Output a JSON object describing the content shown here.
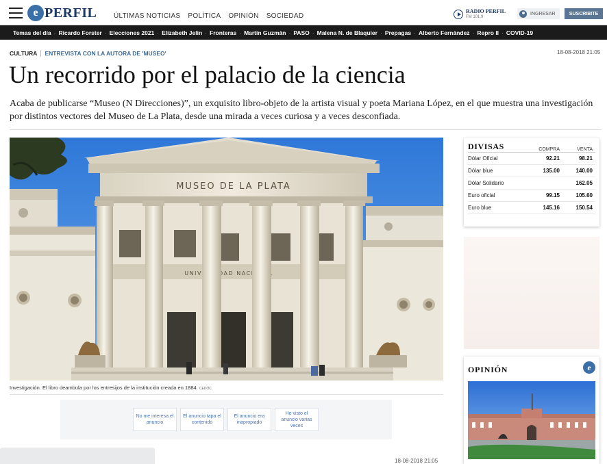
{
  "header": {
    "logo_text": "PERFIL",
    "nav": [
      "ÚLTIMAS NOTICIAS",
      "POLÍTICA",
      "OPINIÓN",
      "SOCIEDAD"
    ],
    "radio_name": "RADIO PERFIL",
    "radio_freq": "FM 101.9",
    "login_label": "INGRESAR",
    "subscribe_label": "SUSCRIBITE"
  },
  "topics": [
    "Temas del día",
    "Ricardo Forster",
    "Elecciones 2021",
    "Elizabeth Jelin",
    "Fronteras",
    "Martín Guzmán",
    "PASO",
    "Malena N. de Blaquier",
    "Prepagas",
    "Alberto Fernández",
    "Repro II",
    "COVID-19"
  ],
  "article": {
    "section": "CULTURA",
    "kicker": "ENTREVISTA CON LA AUTORA DE 'MUSEO'",
    "date": "18-08-2018 21:05",
    "title": "Un recorrido por el palacio de la ciencia",
    "lead": "Acaba de publicarse “Museo (N Direcciones)”, un exquisito libro-objeto de la artista visual y poeta Mariana López, en el que muestra una investigación por distintos vectores del Museo de La Plata, desde una mirada a veces curiosa y a veces desconfiada.",
    "photo_sign": "MUSEO DE LA PLATA",
    "photo_sign2": "UNIVERSIDAD NACIONAL",
    "caption": "Investigación. El libro deambula por los entresijos de la institución creada en 1884.",
    "caption_credit": "CEDOC",
    "date_bottom": "18-08-2018 21:05"
  },
  "ad_feedback": [
    "No me interesa el anuncio",
    "El anuncio tapa el contenido",
    "El anuncio era inapropiado",
    "He visto el anuncio varias veces"
  ],
  "divisas": {
    "title": "DIVISAS",
    "col_buy": "COMPRA",
    "col_sell": "VENTA",
    "rows": [
      {
        "name": "Dólar Oficial",
        "buy": "92.21",
        "sell": "98.21"
      },
      {
        "name": "Dólar blue",
        "buy": "135.00",
        "sell": "140.00"
      },
      {
        "name": "Dólar Solidario",
        "buy": "",
        "sell": "162.05"
      },
      {
        "name": "Euro oficial",
        "buy": "99.15",
        "sell": "105.60"
      },
      {
        "name": "Euro blue",
        "buy": "145.16",
        "sell": "150.54"
      }
    ]
  },
  "opinion": {
    "title": "OPINIÓN"
  },
  "colors": {
    "brand_blue": "#1d3b64",
    "kicker_blue": "#3e6a91",
    "topics_bg": "#1b1b1b",
    "subscribe_bg": "#5c7796"
  }
}
